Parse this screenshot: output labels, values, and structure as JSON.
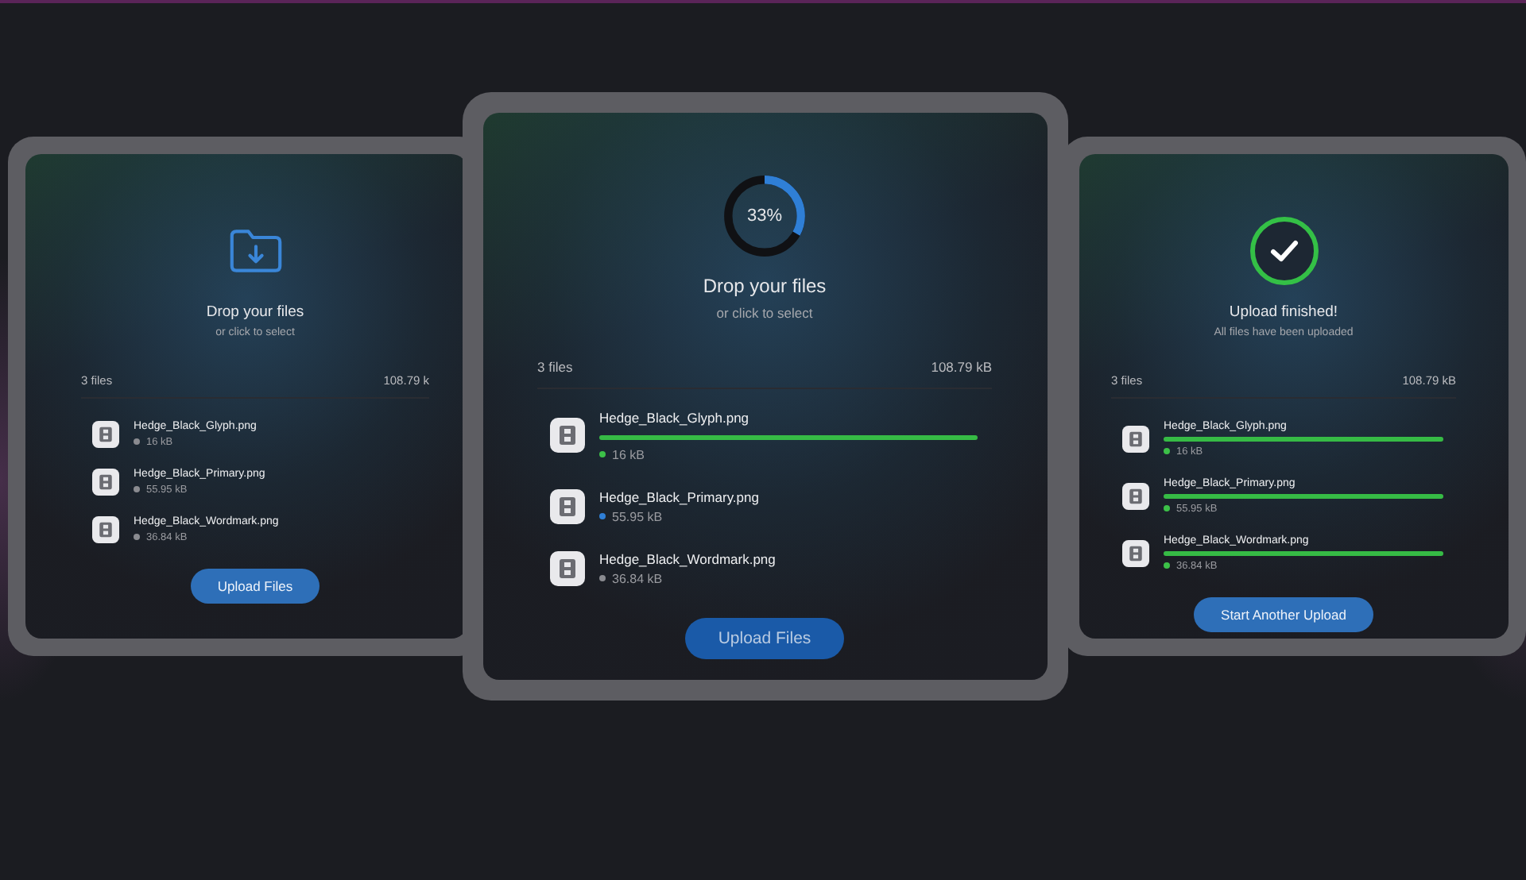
{
  "cards": [
    {
      "focused": false,
      "hero": {
        "kind": "folder"
      },
      "title": "Drop your files",
      "subtitle": "or click to select",
      "count": "3 files",
      "total": "108.79 k",
      "files": [
        {
          "name": "Hedge_Black_Glyph.png",
          "size": "16 kB",
          "color": "#8a8b90"
        },
        {
          "name": "Hedge_Black_Primary.png",
          "size": "55.95 kB",
          "color": "#8a8b90"
        },
        {
          "name": "Hedge_Black_Wordmark.png",
          "size": "36.84 kB",
          "color": "#8a8b90"
        }
      ],
      "button": "Upload Files"
    },
    {
      "focused": true,
      "hero": {
        "kind": "progress",
        "level": 0.33,
        "label": "33%"
      },
      "title": "Drop your files",
      "subtitle": "or click to select",
      "count": "3 files",
      "total": "108.79 kB",
      "files": [
        {
          "name": "Hedge_Black_Glyph.png",
          "size": "16 kB",
          "color": "#3cc048",
          "level": 1
        },
        {
          "name": "Hedge_Black_Primary.png",
          "size": "55.95 kB",
          "color": "#2f7fd6"
        },
        {
          "name": "Hedge_Black_Wordmark.png",
          "size": "36.84 kB",
          "color": "#8a8b90"
        }
      ],
      "button": "Upload Files"
    },
    {
      "focused": false,
      "hero": {
        "kind": "done"
      },
      "title": "Upload finished!",
      "subtitle": "All files have been uploaded",
      "count": "3 files",
      "total": "108.79 kB",
      "files": [
        {
          "name": "Hedge_Black_Glyph.png",
          "size": "16 kB",
          "color": "#3cc048",
          "level": 1
        },
        {
          "name": "Hedge_Black_Primary.png",
          "size": "55.95 kB",
          "color": "#3cc048",
          "level": 1
        },
        {
          "name": "Hedge_Black_Wordmark.png",
          "size": "36.84 kB",
          "color": "#3cc048",
          "level": 1
        }
      ],
      "button": "Start Another Upload"
    }
  ]
}
